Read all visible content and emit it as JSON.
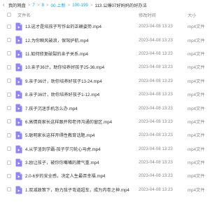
{
  "breadcrumb": {
    "items": [
      "我的网盘",
      "7",
      "8",
      "00.上新",
      "100-199",
      "113.公爆07好妈妈的好办法"
    ]
  },
  "header": {
    "name_label": "文件名",
    "time_label": "修改时间",
    "size_label": "大小"
  },
  "files": [
    {
      "name": "13.这才是培孩子写作业的正确姿势.mp4",
      "time": "2023-04-08 13:23",
      "size": "mp4文件"
    },
    {
      "name": "12.为你瞬风破浪，保驾护航.mp4",
      "time": "2023-04-08 13:23",
      "size": "mp4文件"
    },
    {
      "name": "11.如何修复破裂的亲子关系.mp4",
      "time": "2023-04-08 13:23",
      "size": "mp4文件"
    },
    {
      "name": "10.亲子36计，助你培养好孩子25-36.mp4",
      "time": "2023-04-08 13:23",
      "size": "mp4文件"
    },
    {
      "name": "9.亲子36计，助你培养好孩子13-24.mp4",
      "time": "2023-04-08 13:23",
      "size": "mp4文件"
    },
    {
      "name": "8.亲子36计，助你培养好孩子1-12.mp4",
      "time": "2023-04-08 13:23",
      "size": "mp4文件"
    },
    {
      "name": "7.孩子沉迷手机怎么办.mp4",
      "time": "2023-04-08 13:23",
      "size": "mp4文件"
    },
    {
      "name": "6.高情商家长这样跟开和老师沟通的窗区.mp4",
      "time": "2023-04-08 13:23",
      "size": "mp4文件"
    },
    {
      "name": "5.聪明家长这样开得性教育话题.mp4",
      "time": "2023-04-08 13:23",
      "size": "mp4文件"
    },
    {
      "name": "4.从学渣到学霸-孩子学习轮心马虎.mp4",
      "time": "2023-04-08 13:23",
      "size": "mp4文件"
    },
    {
      "name": "3.励让孩子，被你你嘴嘴的脾气重.mp4",
      "time": "2023-04-08 13:23",
      "size": "mp4文件"
    },
    {
      "name": "2.0-6岁的安全感，决定人生最否幸福.mp4",
      "time": "2023-04-08 13:23",
      "size": "mp4文件"
    },
    {
      "name": "1.双减政策下，助力孩子弯道超车，成为内卷之神.mp4",
      "time": "2023-04-08 13:23",
      "size": "mp4文件"
    }
  ],
  "colors": {
    "accent": "#06a7ff",
    "video_icon": "#8f83f5"
  }
}
